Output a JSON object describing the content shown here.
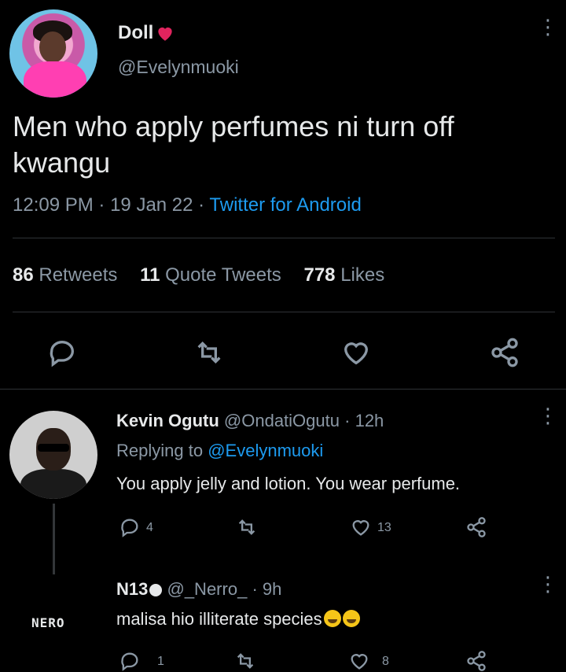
{
  "tweet": {
    "author_name": "Doll",
    "author_handle": "@Evelynmuoki",
    "text": "Men who apply perfumes ni turn off kwangu",
    "time": "12:09 PM",
    "date": "19 Jan 22",
    "source": "Twitter for Android",
    "retweets_count": "86",
    "retweets_label": "Retweets",
    "quotes_count": "11",
    "quotes_label": "Quote Tweets",
    "likes_count": "778",
    "likes_label": "Likes"
  },
  "reply1": {
    "name": "Kevin Ogutu",
    "handle": "@OndatiOgutu",
    "age": "12h",
    "replying_prefix": "Replying to",
    "replying_handle": "@Evelynmuoki",
    "text": "You apply jelly and lotion. You wear perfume.",
    "reply_count": "4",
    "like_count": "13"
  },
  "reply2": {
    "name": "N13",
    "handle": "@_Nerro_",
    "age": "9h",
    "text": "malisa hio illiterate species",
    "avatar_text": "NERO",
    "reply_count": "1",
    "like_count": "8"
  },
  "colors": {
    "background": "#000000",
    "text": "#e7e9ea",
    "muted": "#8b98a5",
    "link": "#1d9bf0",
    "heart": "#e0245e"
  }
}
